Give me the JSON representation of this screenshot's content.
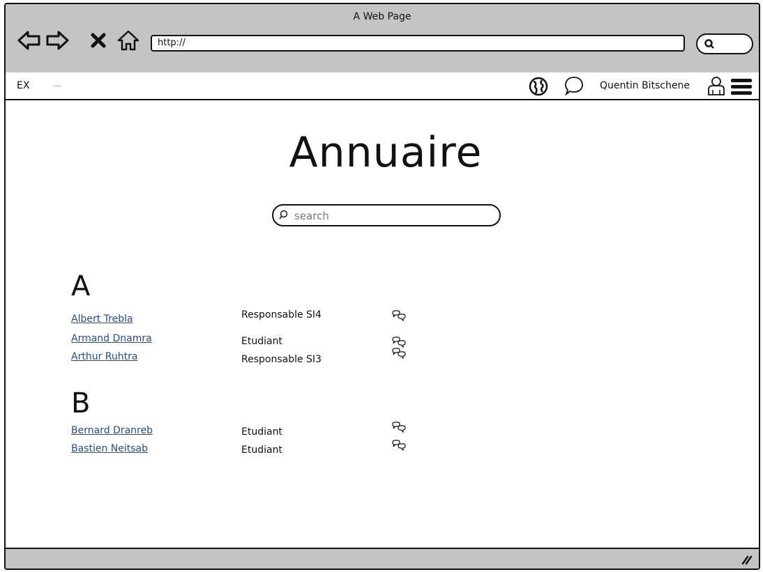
{
  "window": {
    "title": "A Web Page"
  },
  "browser": {
    "url": "http://",
    "icons": [
      "back-arrow-icon",
      "forward-arrow-icon",
      "stop-x-icon",
      "home-icon",
      "search-icon"
    ]
  },
  "topbar": {
    "logo": "EX",
    "logo_suffix": "...",
    "user_name": "Quentin Bitschene",
    "icons": [
      "globe-icon",
      "speech-bubble-icon",
      "user-icon",
      "hamburger-menu-icon"
    ]
  },
  "main": {
    "title": "Annuaire",
    "search": {
      "placeholder": "search",
      "value": ""
    },
    "groups": [
      {
        "letter": "A",
        "entries": [
          {
            "name": "Albert Trebla",
            "role": "Responsable SI4"
          },
          {
            "name": "Armand Dnamra",
            "role": "Etudiant"
          },
          {
            "name": "Arthur Ruhtra",
            "role": "Responsable SI3"
          }
        ]
      },
      {
        "letter": "B",
        "entries": [
          {
            "name": "Bernard Dranreb",
            "role": "Etudiant"
          },
          {
            "name": "Bastien Neitsab",
            "role": "Etudiant"
          }
        ]
      }
    ]
  },
  "colors": {
    "chrome": "#c4c4c4",
    "link": "#1f4c99",
    "ink": "#111111"
  }
}
